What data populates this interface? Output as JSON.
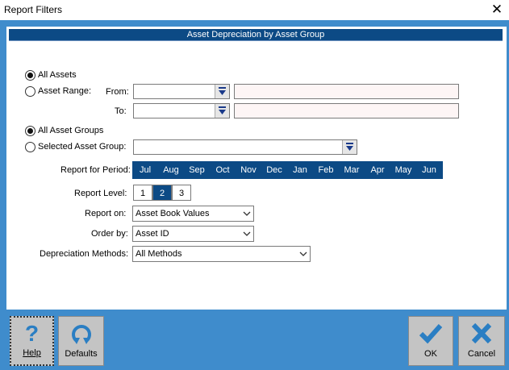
{
  "window": {
    "title": "Report Filters",
    "close_glyph": "✕"
  },
  "header": "Asset Depreciation by Asset Group",
  "assets": {
    "all_label": "All Assets",
    "range_label": "Asset Range:",
    "from_label": "From:",
    "to_label": "To:",
    "selected": "all"
  },
  "groups": {
    "all_label": "All Asset Groups",
    "selected_label": "Selected Asset Group:",
    "selected": "all"
  },
  "period": {
    "label": "Report for Period:",
    "months": [
      "Jul",
      "Aug",
      "Sep",
      "Oct",
      "Nov",
      "Dec",
      "Jan",
      "Feb",
      "Mar",
      "Apr",
      "May",
      "Jun"
    ]
  },
  "level": {
    "label": "Report Level:",
    "options": [
      "1",
      "2",
      "3"
    ],
    "selected": "2"
  },
  "report_on": {
    "label": "Report on:",
    "value": "Asset Book Values"
  },
  "order_by": {
    "label": "Order by:",
    "value": "Asset ID"
  },
  "methods": {
    "label": "Depreciation Methods:",
    "value": "All Methods"
  },
  "buttons": {
    "help": "Help",
    "help_glyph": "?",
    "defaults": "Defaults",
    "ok": "OK",
    "cancel": "Cancel"
  },
  "colors": {
    "frame": "#3f8ccc",
    "header": "#0c4a85",
    "icon": "#2a7ec3"
  }
}
